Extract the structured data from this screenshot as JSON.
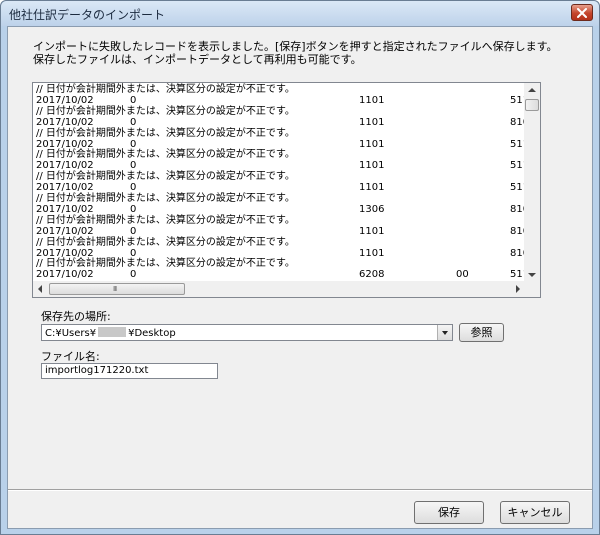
{
  "window": {
    "title": "他社仕訳データのインポート"
  },
  "message": {
    "line1": "インポートに失敗したレコードを表示しました。[保存]ボタンを押すと指定されたファイルへ保存します。",
    "line2": "保存したファイルは、インポートデータとして再利用も可能です。"
  },
  "log": {
    "lines": [
      {
        "type": "error",
        "text": "// 日付が会計期間外または、決算区分の設定が不正です。"
      },
      {
        "type": "record",
        "date": "2017/10/02",
        "c1": "0",
        "c2": "1101",
        "c3": "",
        "c4": "511"
      },
      {
        "type": "error",
        "text": "// 日付が会計期間外または、決算区分の設定が不正です。"
      },
      {
        "type": "record",
        "date": "2017/10/02",
        "c1": "0",
        "c2": "1101",
        "c3": "",
        "c4": "810"
      },
      {
        "type": "error",
        "text": "// 日付が会計期間外または、決算区分の設定が不正です。"
      },
      {
        "type": "record",
        "date": "2017/10/02",
        "c1": "0",
        "c2": "1101",
        "c3": "",
        "c4": "511"
      },
      {
        "type": "error",
        "text": "// 日付が会計期間外または、決算区分の設定が不正です。"
      },
      {
        "type": "record",
        "date": "2017/10/02",
        "c1": "0",
        "c2": "1101",
        "c3": "",
        "c4": "511"
      },
      {
        "type": "error",
        "text": "// 日付が会計期間外または、決算区分の設定が不正です。"
      },
      {
        "type": "record",
        "date": "2017/10/02",
        "c1": "0",
        "c2": "1101",
        "c3": "",
        "c4": "511"
      },
      {
        "type": "error",
        "text": "// 日付が会計期間外または、決算区分の設定が不正です。"
      },
      {
        "type": "record",
        "date": "2017/10/02",
        "c1": "0",
        "c2": "1306",
        "c3": "",
        "c4": "810"
      },
      {
        "type": "error",
        "text": "// 日付が会計期間外または、決算区分の設定が不正です。"
      },
      {
        "type": "record",
        "date": "2017/10/02",
        "c1": "0",
        "c2": "1101",
        "c3": "",
        "c4": "810"
      },
      {
        "type": "error",
        "text": "// 日付が会計期間外または、決算区分の設定が不正です。"
      },
      {
        "type": "record",
        "date": "2017/10/02",
        "c1": "0",
        "c2": "1101",
        "c3": "",
        "c4": "810"
      },
      {
        "type": "error",
        "text": "// 日付が会計期間外または、決算区分の設定が不正です。"
      },
      {
        "type": "record",
        "date": "2017/10/02",
        "c1": "0",
        "c2": "6208",
        "c3": "00",
        "c4": "511"
      }
    ]
  },
  "save_location": {
    "label": "保存先の場所:",
    "path_prefix": "C:¥Users¥",
    "path_suffix": "¥Desktop",
    "browse_label": "参照"
  },
  "file_name": {
    "label": "ファイル名:",
    "value": "importlog171220.txt"
  },
  "footer": {
    "save_label": "保存",
    "cancel_label": "キャンセル"
  },
  "colors": {
    "title_bg": "#bdd2ea",
    "client_bg": "#f0f0f0",
    "close_button": "#c4452c"
  },
  "icons": {
    "close": "close-x-icon",
    "scroll_up": "scroll-up-arrow-icon",
    "scroll_down": "scroll-down-arrow-icon",
    "scroll_left": "scroll-left-arrow-icon",
    "scroll_right": "scroll-right-arrow-icon",
    "combo": "chevron-down-icon"
  }
}
